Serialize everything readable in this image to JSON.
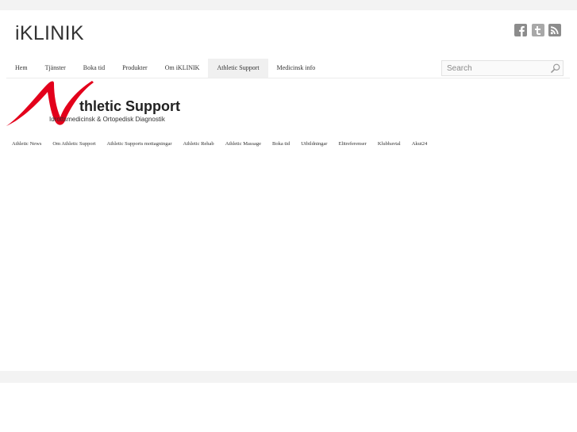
{
  "site": {
    "brand": "iKLINIK"
  },
  "social": [
    {
      "icon": "facebook-icon",
      "glyph": "f",
      "color": "#888888"
    },
    {
      "icon": "twitter-icon",
      "glyph": "t",
      "color": "#888888"
    },
    {
      "icon": "rss-icon",
      "glyph": "",
      "color": "#888888"
    }
  ],
  "nav": {
    "items": [
      "Hem",
      "Tjänster",
      "Boka tid",
      "Produkter",
      "Om iKLINIK",
      "Athletic Support",
      "Medicinsk info"
    ],
    "active": "Athletic Support"
  },
  "search": {
    "placeholder": "Search"
  },
  "logo": {
    "wordmark": "thletic Support",
    "tagline": "Idrottsmedicinsk & Ortopedisk Diagnostik",
    "color": "#e3001b"
  },
  "subnav": {
    "items": [
      "Athletic News",
      "Om Athletic Support",
      "Athletic Supports mottagningar",
      "Athletic Rehab",
      "Athletic Massage",
      "Boka tid",
      "Utbildningar",
      "Elitreferenser",
      "Klubbavtal",
      "Akut24"
    ]
  }
}
